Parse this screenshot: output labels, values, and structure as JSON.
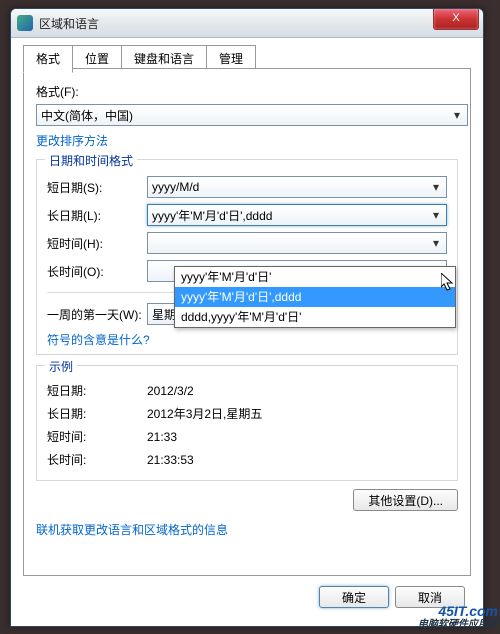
{
  "window": {
    "title": "区域和语言",
    "close": "X"
  },
  "tabs": [
    "格式",
    "位置",
    "键盘和语言",
    "管理"
  ],
  "format": {
    "label": "格式(F):",
    "value": "中文(简体，中国)",
    "sort_link": "更改排序方法"
  },
  "datetime_group": {
    "legend": "日期和时间格式",
    "short_date_lbl": "短日期(S):",
    "short_date_val": "yyyy/M/d",
    "long_date_lbl": "长日期(L):",
    "long_date_val": "yyyy'年'M'月'd'日',dddd",
    "short_time_lbl": "短时间(H):",
    "short_time_val": "",
    "long_time_lbl": "长时间(O):",
    "long_time_val": "",
    "first_day_lbl": "一周的第一天(W):",
    "first_day_val": "星期日",
    "symbols_link": "符号的含意是什么?"
  },
  "long_date_options": [
    "yyyy'年'M'月'd'日'",
    "yyyy'年'M'月'd'日',dddd",
    "dddd,yyyy'年'M'月'd'日'"
  ],
  "long_date_selected_index": 1,
  "examples": {
    "legend": "示例",
    "short_date_lbl": "短日期:",
    "short_date_val": "2012/3/2",
    "long_date_lbl": "长日期:",
    "long_date_val": "2012年3月2日,星期五",
    "short_time_lbl": "短时间:",
    "short_time_val": "21:33",
    "long_time_lbl": "长时间:",
    "long_time_val": "21:33:53"
  },
  "other_settings_btn": "其他设置(D)...",
  "online_link": "联机获取更改语言和区域格式的信息",
  "ok_btn": "确定",
  "cancel_btn": "取消",
  "watermark": {
    "domain": "45IT.com",
    "sub": "电脑软硬件应用网"
  }
}
